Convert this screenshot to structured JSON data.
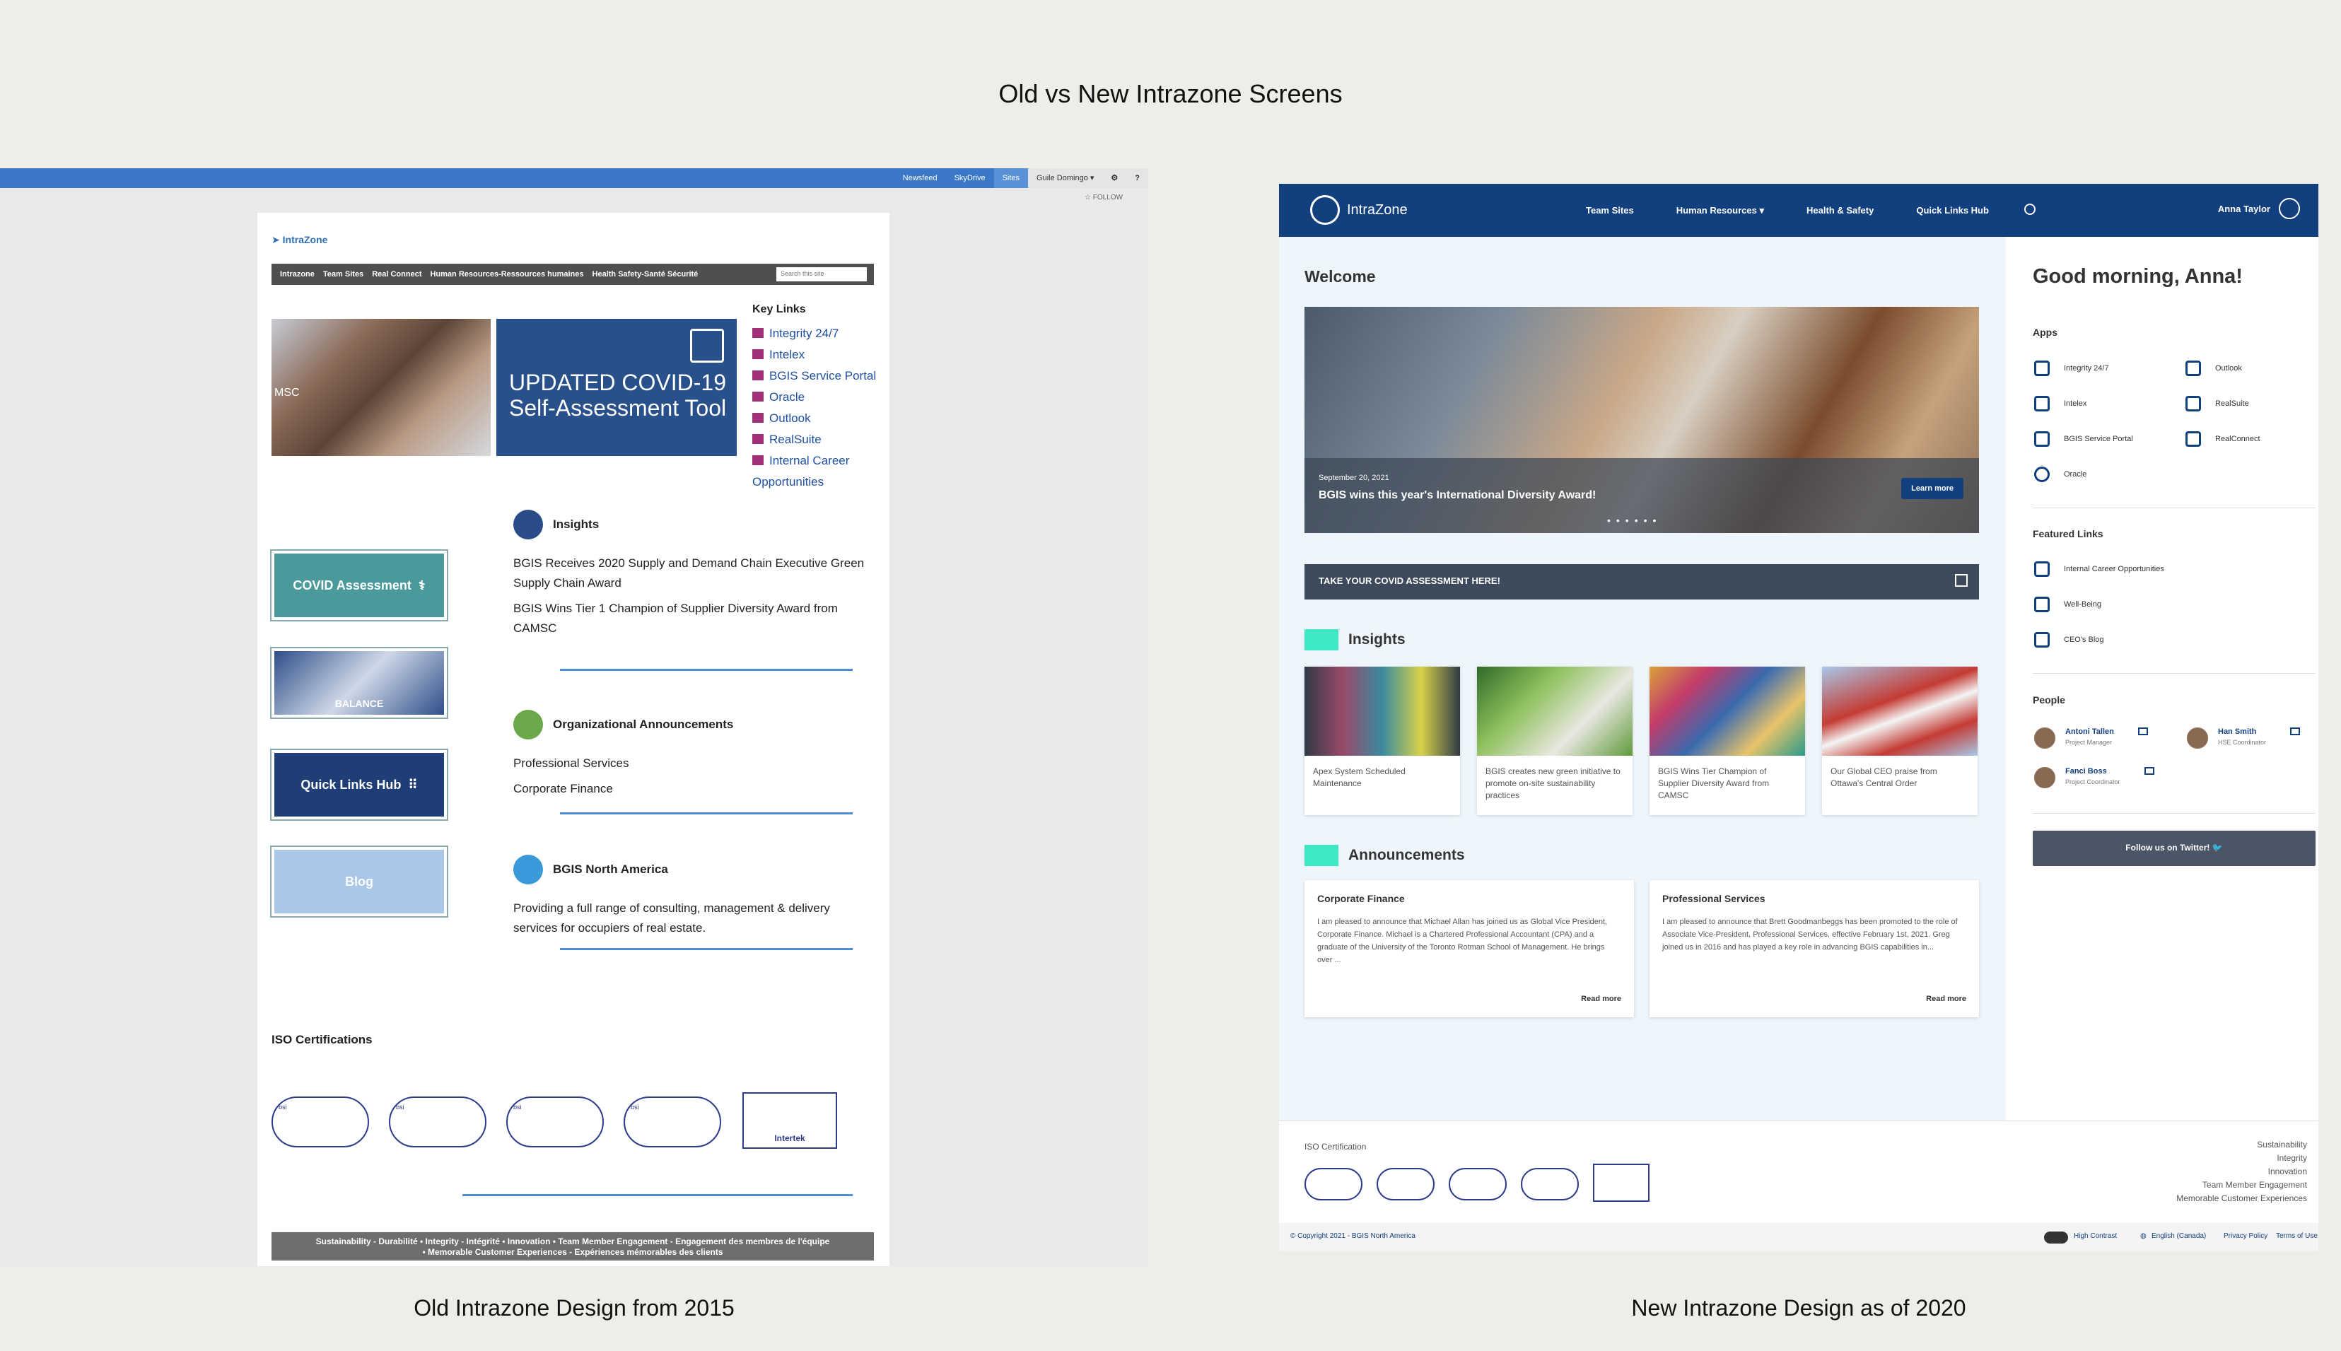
{
  "page_title": "Old vs New Intrazone Screens",
  "captions": {
    "old": "Old Intrazone Design from 2015",
    "new": "New Intrazone Design as of 2020"
  },
  "old": {
    "topnav": [
      "Newsfeed",
      "SkyDrive",
      "Sites"
    ],
    "user": "Guile Domingo ▾",
    "gear": "⚙",
    "help": "?",
    "follow": "☆ FOLLOW",
    "logo": "IntraZone",
    "nav": [
      "Intrazone",
      "Team Sites",
      "Real Connect",
      "Human Resources-Ressources humaines",
      "Health Safety-Santé Sécurité"
    ],
    "search_placeholder": "Search this site",
    "hands_label": "MSC",
    "covid_banner": "UPDATED COVID-19 Self-Assessment Tool",
    "key_links_title": "Key Links",
    "key_links": [
      "Integrity 24/7",
      "Intelex",
      "BGIS Service Portal",
      "Oracle",
      "Outlook",
      "RealSuite",
      "Internal Career Opportunities"
    ],
    "tiles": {
      "covid": "COVID Assessment",
      "balance": "BALANCE",
      "quicklinks": "Quick Links Hub",
      "blog": "Blog"
    },
    "insights": {
      "title": "Insights",
      "items": [
        "BGIS Receives 2020 Supply and Demand Chain Executive Green Supply Chain Award",
        "BGIS Wins Tier 1 Champion of Supplier Diversity Award from CAMSC"
      ]
    },
    "org": {
      "title": "Organizational Announcements",
      "items": [
        "Professional Services",
        "Corporate Finance"
      ]
    },
    "bgis_na": {
      "title": "BGIS North America",
      "text": "Providing a full range of consulting, management & delivery services for occupiers of real estate."
    },
    "iso_title": "ISO Certifications",
    "intertek": "Intertek",
    "footer_line1": "Sustainability - Durabilité   •   Integrity - Intégrité   •   Innovation   •   Team Member Engagement - Engagement des membres de l'équipe",
    "footer_line2": "•   Memorable Customer Experiences - Expériences mémorables des clients"
  },
  "new": {
    "logo": "IntraZone",
    "menu": [
      "Team Sites",
      "Human Resources ▾",
      "Health & Safety",
      "Quick Links Hub"
    ],
    "user": "Anna Taylor",
    "welcome": "Welcome",
    "hero": {
      "date": "September 20, 2021",
      "title": "BGIS wins this year's International Diversity Award!",
      "button": "Learn more",
      "dots": "••••••"
    },
    "covid_bar": "TAKE YOUR COVID ASSESSMENT HERE!",
    "insights_title": "Insights",
    "insights": [
      {
        "text": "Apex System Scheduled Maintenance",
        "color": "#2f3a46"
      },
      {
        "text": "BGIS creates new green initiative to promote on-site sustainability practices",
        "color": "#5f9a3a"
      },
      {
        "text": "BGIS Wins Tier Champion of Supplier Diversity Award from CAMSC",
        "color": "#d9a23a"
      },
      {
        "text": "Our Global CEO praise from Ottawa's Central Order",
        "color": "#c43b34"
      }
    ],
    "announcements_title": "Announcements",
    "announcements": [
      {
        "title": "Corporate Finance",
        "body": "I am pleased to announce that Michael Allan has joined us as Global Vice President, Corporate Finance. Michael is a Chartered Professional Accountant (CPA) and a graduate of the University of the Toronto Rotman School of Management. He brings over ...",
        "link": "Read more"
      },
      {
        "title": "Professional Services",
        "body": "I am pleased to announce that Brett Goodmanbeggs has been promoted to the role of Associate Vice-President, Professional Services, effective February 1st, 2021. Greg joined us in 2016 and has played a key role in advancing BGIS capabilities in...",
        "link": "Read more"
      }
    ],
    "greeting": "Good morning, Anna!",
    "apps_title": "Apps",
    "apps": [
      "Integrity 24/7",
      "Outlook",
      "Intelex",
      "RealSuite",
      "BGIS Service Portal",
      "RealConnect",
      "Oracle"
    ],
    "featured_title": "Featured Links",
    "featured": [
      "Internal Career Opportunities",
      "Well-Being",
      "CEO's Blog"
    ],
    "people_title": "People",
    "people": [
      {
        "name": "Antoni Tallen",
        "role": "Project Manager"
      },
      {
        "name": "Han Smith",
        "role": "HSE Coordinator"
      },
      {
        "name": "Fanci Boss",
        "role": "Project Coordinator"
      }
    ],
    "twitter": "Follow us on Twitter!",
    "iso_label": "ISO Certification",
    "footer_links": [
      "Sustainability",
      "Integrity",
      "Innovation",
      "Team Member Engagement",
      "Memorable Customer Experiences"
    ],
    "copyright": "© Copyright 2021 - BGIS North America",
    "bottom_links": [
      "High Contrast",
      "English (Canada)",
      "Privacy Policy",
      "Terms of Use"
    ]
  }
}
